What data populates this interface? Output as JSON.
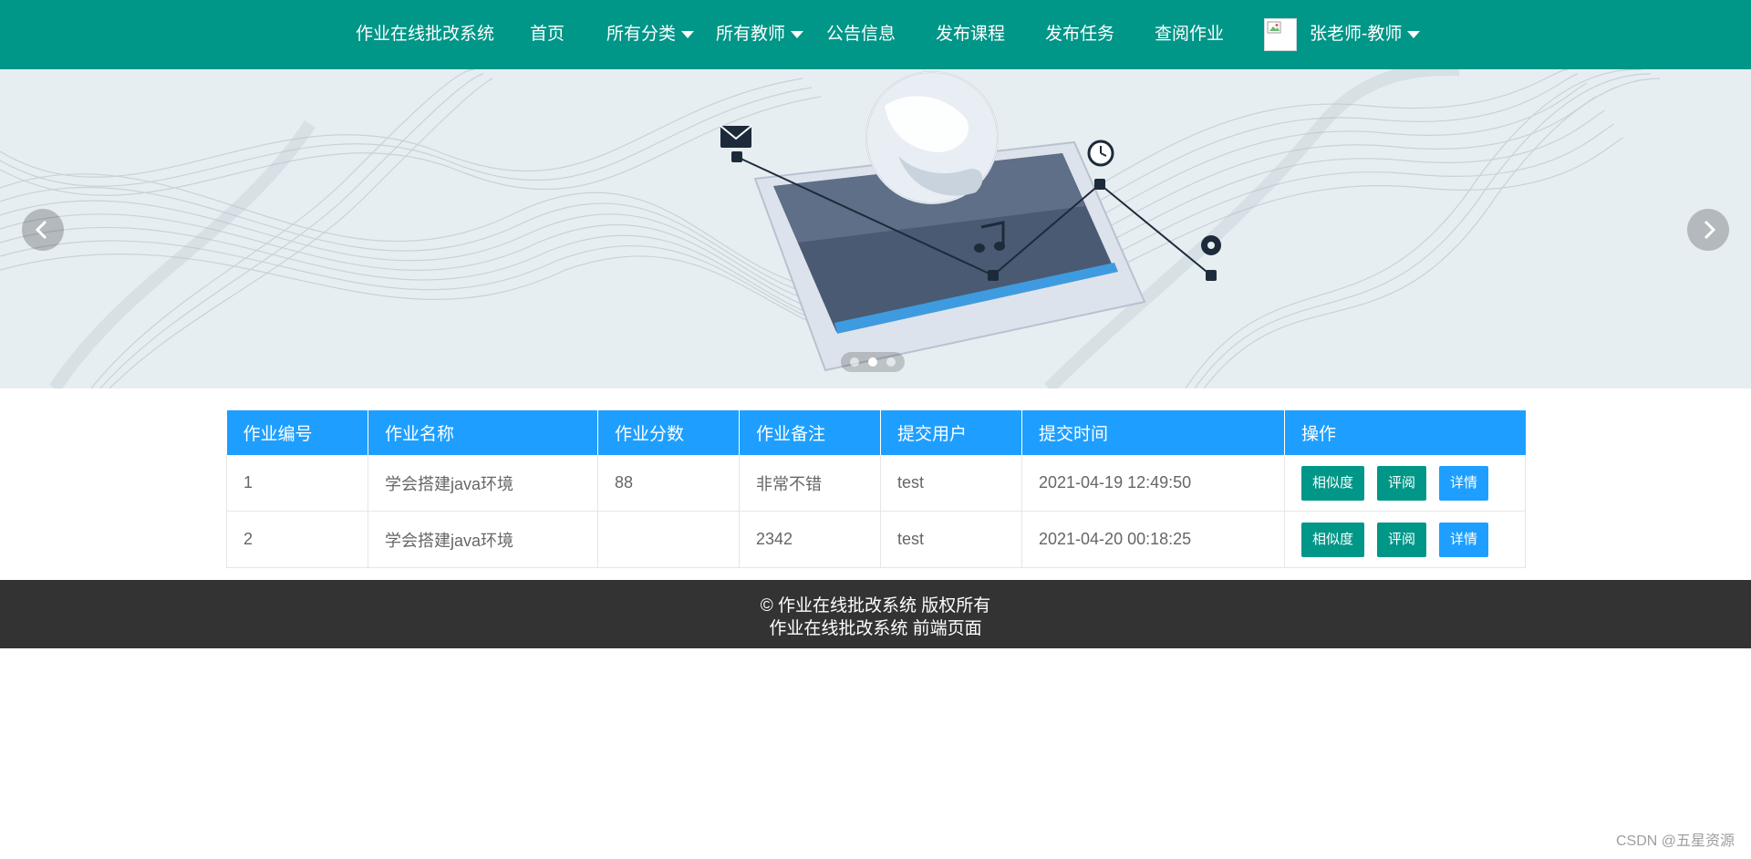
{
  "nav": {
    "brand": "作业在线批改系统",
    "items": [
      {
        "label": "首页",
        "dropdown": false
      },
      {
        "label": "所有分类",
        "dropdown": true
      },
      {
        "label": "所有教师",
        "dropdown": true
      },
      {
        "label": "公告信息",
        "dropdown": false
      },
      {
        "label": "发布课程",
        "dropdown": false
      },
      {
        "label": "发布任务",
        "dropdown": false
      },
      {
        "label": "查阅作业",
        "dropdown": false
      }
    ],
    "user": "张老师-教师",
    "colors": {
      "bar": "#009688"
    }
  },
  "banner": {
    "prev_icon": "chevron-left-icon",
    "next_icon": "chevron-right-icon",
    "slide_count": 3,
    "active_slide": 2
  },
  "table": {
    "columns": [
      "作业编号",
      "作业名称",
      "作业分数",
      "作业备注",
      "提交用户",
      "提交时间",
      "操作"
    ],
    "rows": [
      {
        "id": "1",
        "name": "学会搭建java环境",
        "score": "88",
        "remark": "非常不错",
        "user": "test",
        "time": "2021-04-19 12:49:50"
      },
      {
        "id": "2",
        "name": "学会搭建java环境",
        "score": "",
        "remark": "2342",
        "user": "test",
        "time": "2021-04-20 00:18:25"
      }
    ],
    "actions": {
      "similarity": "相似度",
      "review": "评阅",
      "detail": "详情"
    },
    "colors": {
      "header": "#1e9fff",
      "green_button": "#009688",
      "blue_button": "#1e9fff"
    }
  },
  "footer": {
    "line1": "© 作业在线批改系统 版权所有",
    "line2": "作业在线批改系统 前端页面"
  },
  "watermark": "CSDN @五星资源"
}
